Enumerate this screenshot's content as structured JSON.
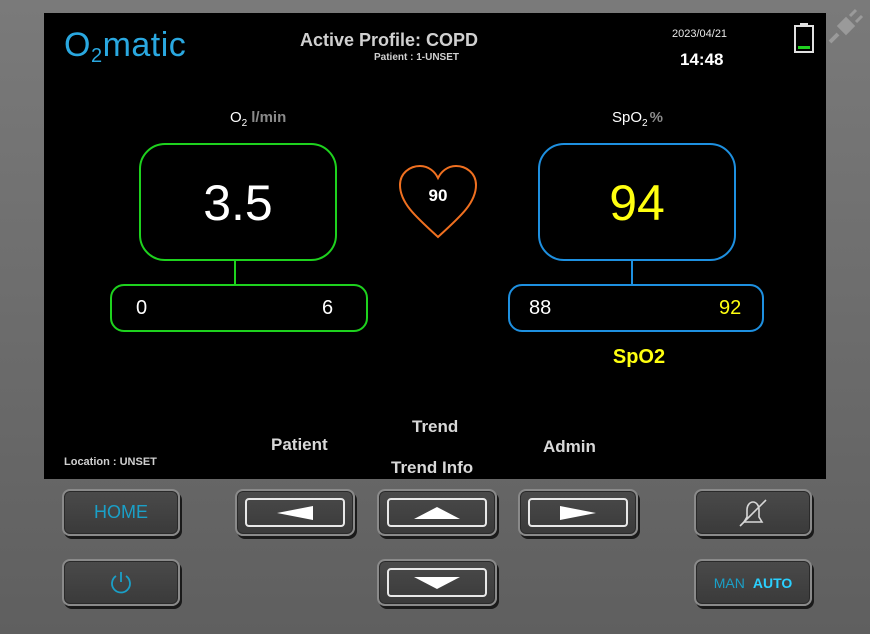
{
  "header": {
    "logo": {
      "o": "O",
      "sub": "2",
      "rest": "matic"
    },
    "active_profile": "Active Profile: COPD",
    "patient": "Patient : 1-UNSET",
    "date": "2023/04/21",
    "time": "14:48"
  },
  "o2": {
    "label": "O",
    "label_sub": "2",
    "unit": "l/min",
    "value": "3.5",
    "min": "0",
    "max": "6",
    "color": "#1ed21e"
  },
  "pulse": {
    "value": "90",
    "color": "#f07020"
  },
  "spo2": {
    "label": "SpO",
    "label_sub": "2",
    "unit": "%",
    "value": "94",
    "min": "88",
    "max": "92",
    "mode": "SpO2",
    "color": "#1e90e0",
    "value_color": "#ffff10"
  },
  "soft_labels": {
    "left": "Patient",
    "up": "Trend",
    "down": "Trend Info",
    "right": "Admin"
  },
  "location": "Location : UNSET",
  "buttons": {
    "home": "HOME",
    "man": "MAN",
    "auto": "AUTO"
  },
  "icons": [
    "battery-icon",
    "plug-icon",
    "heart-icon",
    "power-icon",
    "alarm-mute-icon",
    "arrow-left-icon",
    "arrow-up-icon",
    "arrow-down-icon",
    "arrow-right-icon"
  ]
}
